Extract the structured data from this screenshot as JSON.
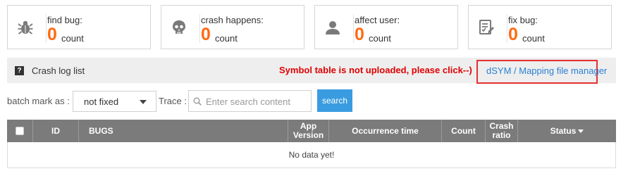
{
  "stats": [
    {
      "label": "find bug:",
      "value": "0",
      "unit": "count",
      "icon": "bug-icon"
    },
    {
      "label": "crash happens:",
      "value": "0",
      "unit": "count",
      "icon": "skull-icon"
    },
    {
      "label": "affect user:",
      "value": "0",
      "unit": "count",
      "icon": "user-icon"
    },
    {
      "label": "fix bug:",
      "value": "0",
      "unit": "count",
      "icon": "fix-checklist-icon"
    }
  ],
  "crash_log": {
    "icon": "?",
    "title": "Crash log list",
    "warning": "Symbol table is not uploaded, please click--)",
    "link": "dSYM / Mapping file manager"
  },
  "filters": {
    "batch_label": "batch mark as :",
    "batch_value": "not fixed",
    "trace_label": "Trace :",
    "search_placeholder": "Enter search content",
    "search_button": "search"
  },
  "table": {
    "columns": {
      "id": "ID",
      "bugs": "BUGS",
      "app_version_1": "App",
      "app_version_2": "Version",
      "occurrence": "Occurrence time",
      "count": "Count",
      "crash_ratio_1": "Crash",
      "crash_ratio_2": "ratio",
      "status": "Status"
    },
    "empty_text": "No data yet!"
  },
  "colors": {
    "accent_orange": "#ff6a13",
    "warning_red": "#e00000",
    "link_blue": "#2a7fd4",
    "button_blue": "#3a9ce0",
    "header_gray": "#7b7b7b"
  }
}
